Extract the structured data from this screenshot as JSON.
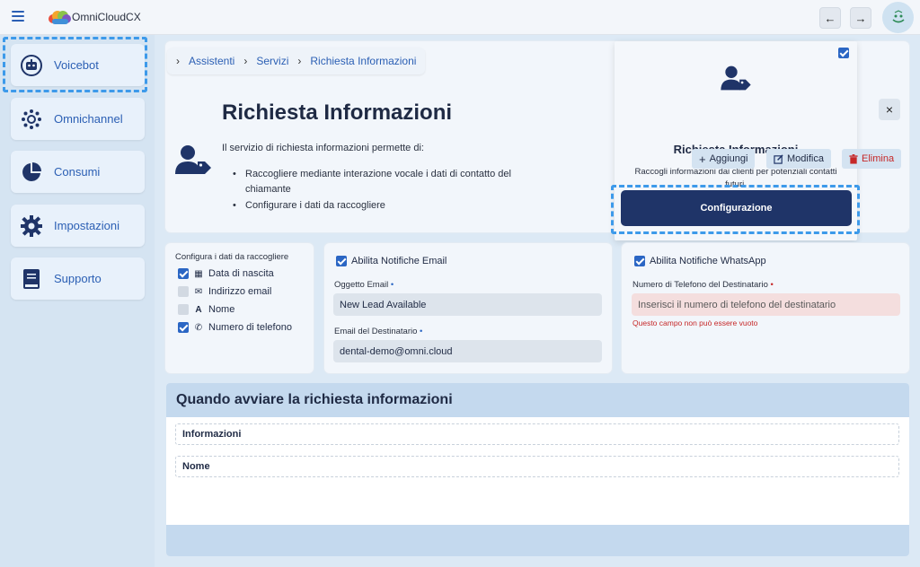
{
  "app": {
    "brand": "OmniCloudCX"
  },
  "topbar": {
    "back_label": "←",
    "forward_label": "→"
  },
  "sidebar": {
    "items": [
      {
        "label": "Voicebot",
        "icon": "robot-icon"
      },
      {
        "label": "Omnichannel",
        "icon": "hub-icon"
      },
      {
        "label": "Consumi",
        "icon": "pie-chart-icon"
      },
      {
        "label": "Impostazioni",
        "icon": "gear-icon"
      },
      {
        "label": "Supporto",
        "icon": "book-icon"
      }
    ]
  },
  "breadcrumb": {
    "items": [
      "Assistenti",
      "Servizi",
      "Richiesta Informazioni"
    ]
  },
  "service": {
    "title": "Richiesta Informazioni",
    "description": "Il servizio di richiesta informazioni permette di:",
    "bullets": [
      "Raccogliere mediante interazione vocale i dati di contatto del chiamante",
      "Configurare i dati da raccogliere"
    ]
  },
  "service_card": {
    "title": "Richiesta Informazioni",
    "subtitle": "Raccogli informazioni dai clienti per potenziali contatti futuri.",
    "config_button": "Configurazione",
    "close_label": "×"
  },
  "collect": {
    "heading": "Configura i dati da raccogliere",
    "fields": [
      {
        "label": "Data di nascita",
        "checked": true,
        "icon": "cake-icon",
        "glyph": "▦"
      },
      {
        "label": "Indirizzo email",
        "checked": false,
        "icon": "envelope-icon",
        "glyph": "✉"
      },
      {
        "label": "Nome",
        "checked": false,
        "icon": "font-icon",
        "glyph": "A"
      },
      {
        "label": "Numero di telefono",
        "checked": true,
        "icon": "phone-icon",
        "glyph": "✆"
      }
    ]
  },
  "email": {
    "toggle_label": "Abilita Notifiche Email",
    "subject_label": "Oggetto Email",
    "subject_value": "New Lead Available",
    "recipient_label": "Email del Destinatario",
    "recipient_value": "dental-demo@omni.cloud",
    "required_mark": "•"
  },
  "whatsapp": {
    "toggle_label": "Abilita Notifiche WhatsApp",
    "phone_label": "Numero di Telefono del Destinatario",
    "phone_placeholder": "Inserisci il numero di telefono del destinatario",
    "error": "Questo campo non può essere vuoto",
    "required_mark": "•"
  },
  "trigger": {
    "title": "Quando avviare la richiesta informazioni",
    "items": [
      "Informazioni",
      "Nome"
    ],
    "add_label": "Aggiungi",
    "edit_label": "Modifica",
    "delete_label": "Elimina"
  },
  "colors": {
    "primary": "#1f3468",
    "accent": "#2b5fb4",
    "danger": "#c62828",
    "highlight": "#3d9aea"
  }
}
